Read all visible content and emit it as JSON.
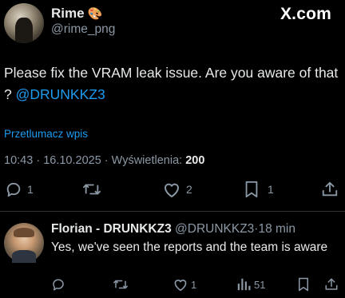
{
  "watermark": "X.com",
  "author": {
    "name": "Rime",
    "emoji": "🎨",
    "handle": "@rime_png"
  },
  "tweet": {
    "text": "Please fix the VRAM leak issue. Are you aware of that ? ",
    "mention": "@DRUNKKZ3"
  },
  "translate_label": "Przetlumacz wpis",
  "meta": {
    "time": "10:43",
    "date": "16.10.2025",
    "views_label": "Wyświetlenia:",
    "views": "200"
  },
  "actions": {
    "replies": "1",
    "reposts": "",
    "likes": "2",
    "bookmarks": "1"
  },
  "reply": {
    "name": "Florian - DRUNKKZ3",
    "handle": "@DRUNKKZ3",
    "age": "18 min",
    "text": "Yes, we've seen the reports and the team is aware",
    "likes": "1",
    "views": "51"
  },
  "colors": {
    "background": "#000000",
    "accent": "#1d9bf0",
    "muted": "#8b98a5",
    "text": "#e7e9ea"
  }
}
